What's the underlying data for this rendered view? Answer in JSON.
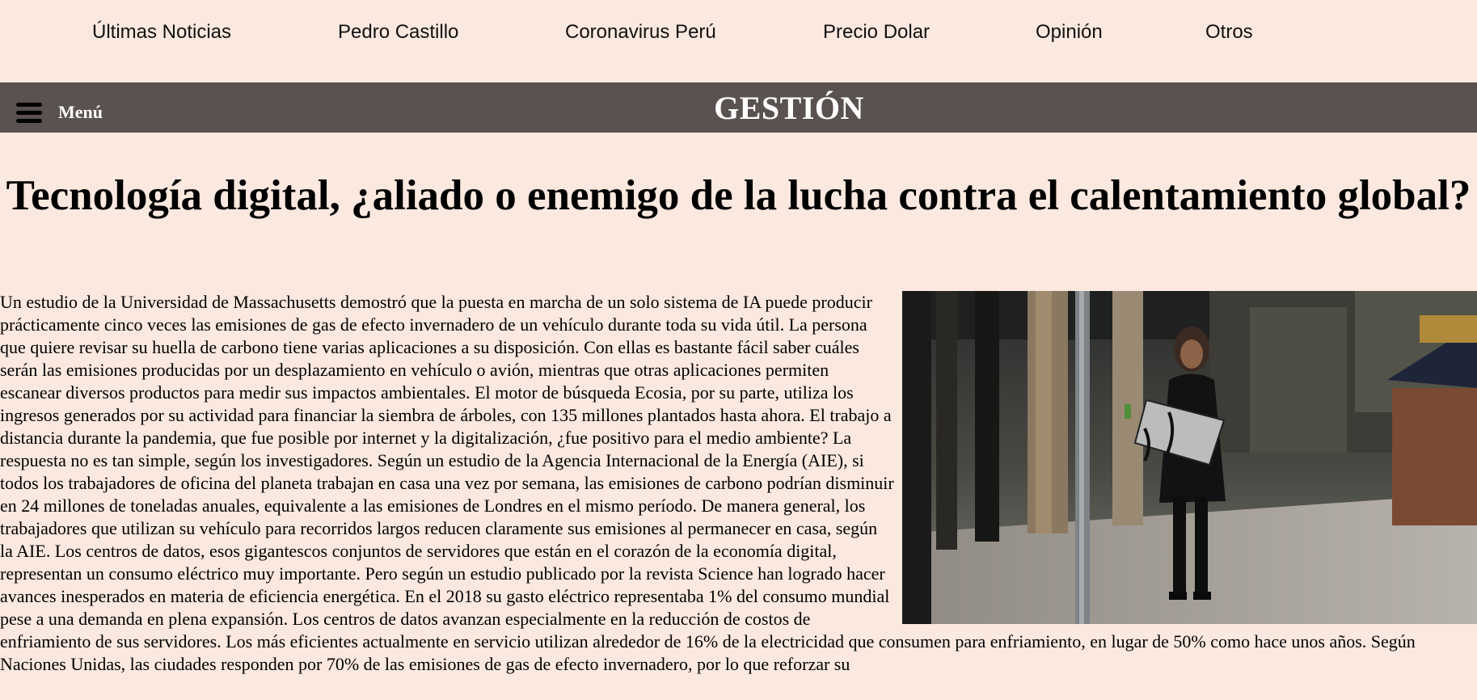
{
  "top_nav": {
    "items": [
      {
        "label": "Últimas Noticias"
      },
      {
        "label": "Pedro Castillo"
      },
      {
        "label": "Coronavirus Perú"
      },
      {
        "label": "Precio Dolar"
      },
      {
        "label": "Opinión"
      },
      {
        "label": "Otros"
      }
    ]
  },
  "header": {
    "menu_icon": "hamburger-menu-icon",
    "menu_label": "Menú",
    "brand": "GESTIÓN",
    "bar_color": "#5a5250"
  },
  "article": {
    "title": "Tecnología digital, ¿aliado o enemigo de la lucha contra el calentamiento global?",
    "body": "Un estudio de la Universidad de Massachusetts demostró que la puesta en marcha de un solo sistema de IA puede producir prácticamente cinco veces las emisiones de gas de efecto invernadero de un vehículo durante toda su vida útil. La persona que quiere revisar su huella de carbono tiene varias aplicaciones a su disposición. Con ellas es bastante fácil saber cuáles serán las emisiones producidas por un desplazamiento en vehículo o avión, mientras que otras aplicaciones permiten escanear diversos productos para medir sus impactos ambientales. El motor de búsqueda Ecosia, por su parte, utiliza los ingresos generados por su actividad para financiar la siembra de árboles, con 135 millones plantados hasta ahora. El trabajo a distancia durante la pandemia, que fue posible por internet y la digitalización, ¿fue positivo para el medio ambiente? La respuesta no es tan simple, según los investigadores. Según un estudio de la Agencia Internacional de la Energía (AIE), si todos los trabajadores de oficina del planeta trabajan en casa una vez por semana, las emisiones de carbono podrían disminuir en 24 millones de toneladas anuales, equivalente a las emisiones de Londres en el mismo período. De manera general, los trabajadores que utilizan su vehículo para recorridos largos reducen claramente sus emisiones al permanecer en casa, según la AIE. Los centros de datos, esos gigantescos conjuntos de servidores que están en el corazón de la economía digital, representan un consumo eléctrico muy importante. Pero según un estudio publicado por la revista Science han logrado hacer avances inesperados en materia de eficiencia energética. En el 2018 su gasto eléctrico representaba 1% del consumo mundial pese a una demanda en plena expansión. Los centros de datos avanzan especialmente en la reducción de costos de enfriamiento de sus servidores. Los más eficientes actualmente en servicio utilizan alrededor de 16% de la electricidad que consumen para enfriamiento, en lugar de 50% como hace unos años. Según Naciones Unidas, las ciudades responden por 70% de las emisiones de gas de efecto invernadero, por lo que reforzar su"
  },
  "colors": {
    "page_background": "#fbe8df",
    "text": "#000000"
  }
}
